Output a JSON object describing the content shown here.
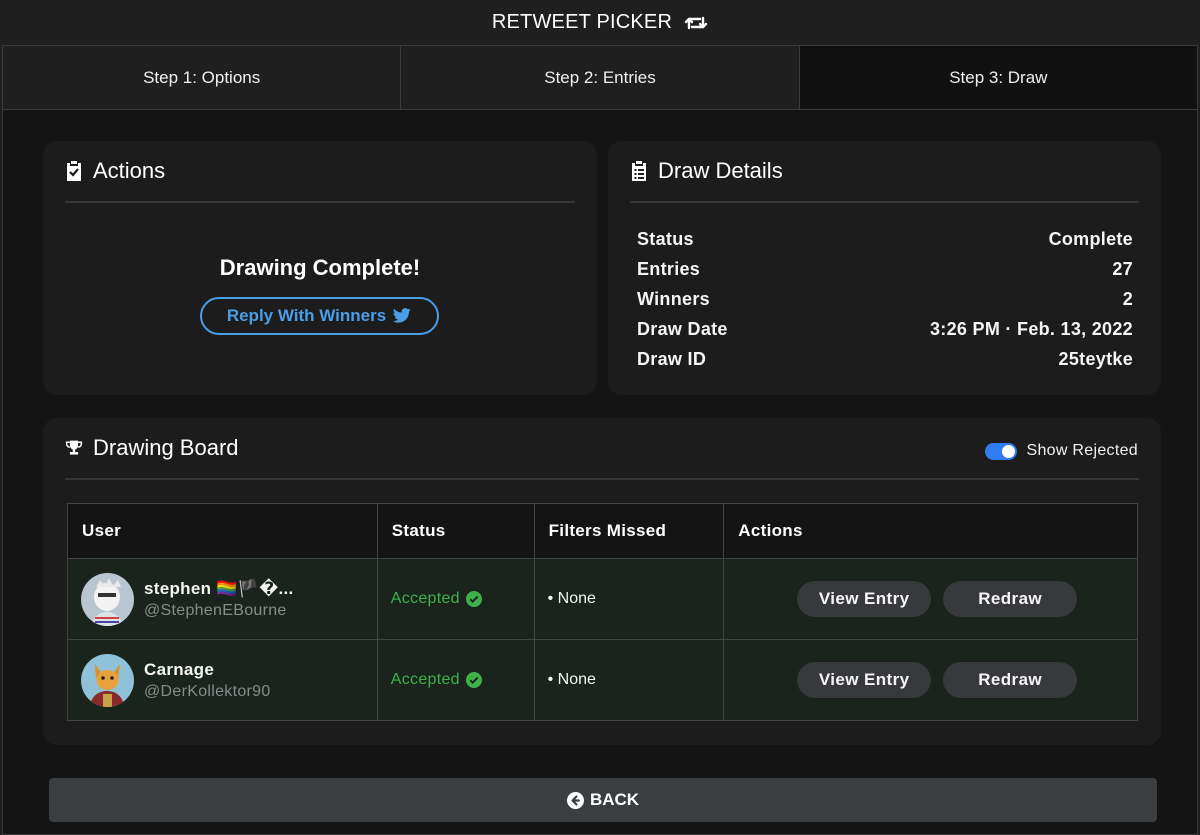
{
  "app": {
    "title": "RETWEET PICKER",
    "icon": "retweet-icon"
  },
  "tabs": [
    {
      "label": "Step 1: Options",
      "active": false
    },
    {
      "label": "Step 2: Entries",
      "active": false
    },
    {
      "label": "Step 3: Draw",
      "active": true
    }
  ],
  "actions": {
    "title": "Actions",
    "icon": "clipboard-check-icon",
    "message": "Drawing Complete!",
    "reply_button": "Reply With Winners",
    "reply_icon": "twitter-icon"
  },
  "details": {
    "title": "Draw Details",
    "icon": "clipboard-list-icon",
    "rows": [
      {
        "label": "Status",
        "value": "Complete"
      },
      {
        "label": "Entries",
        "value": "27"
      },
      {
        "label": "Winners",
        "value": "2"
      },
      {
        "label": "Draw Date",
        "value": "3:26 PM · Feb. 13, 2022"
      },
      {
        "label": "Draw ID",
        "value": "25teytke"
      }
    ]
  },
  "board": {
    "title": "Drawing Board",
    "icon": "trophy-icon",
    "toggle_label": "Show Rejected",
    "toggle_on": true,
    "columns": [
      "User",
      "Status",
      "Filters Missed",
      "Actions"
    ],
    "rows": [
      {
        "name": "stephen 🏳️‍🌈🏴�...",
        "handle": "@StephenEBourne",
        "status": "Accepted",
        "filters": "• None",
        "view_label": "View Entry",
        "redraw_label": "Redraw"
      },
      {
        "name": "Carnage",
        "handle": "@DerKollektor90",
        "status": "Accepted",
        "filters": "• None",
        "view_label": "View Entry",
        "redraw_label": "Redraw"
      }
    ]
  },
  "back_button": "BACK",
  "colors": {
    "accent_blue": "#4a9ee8",
    "accepted_green": "#3fb14a",
    "toggle_blue": "#2f7bf0"
  }
}
